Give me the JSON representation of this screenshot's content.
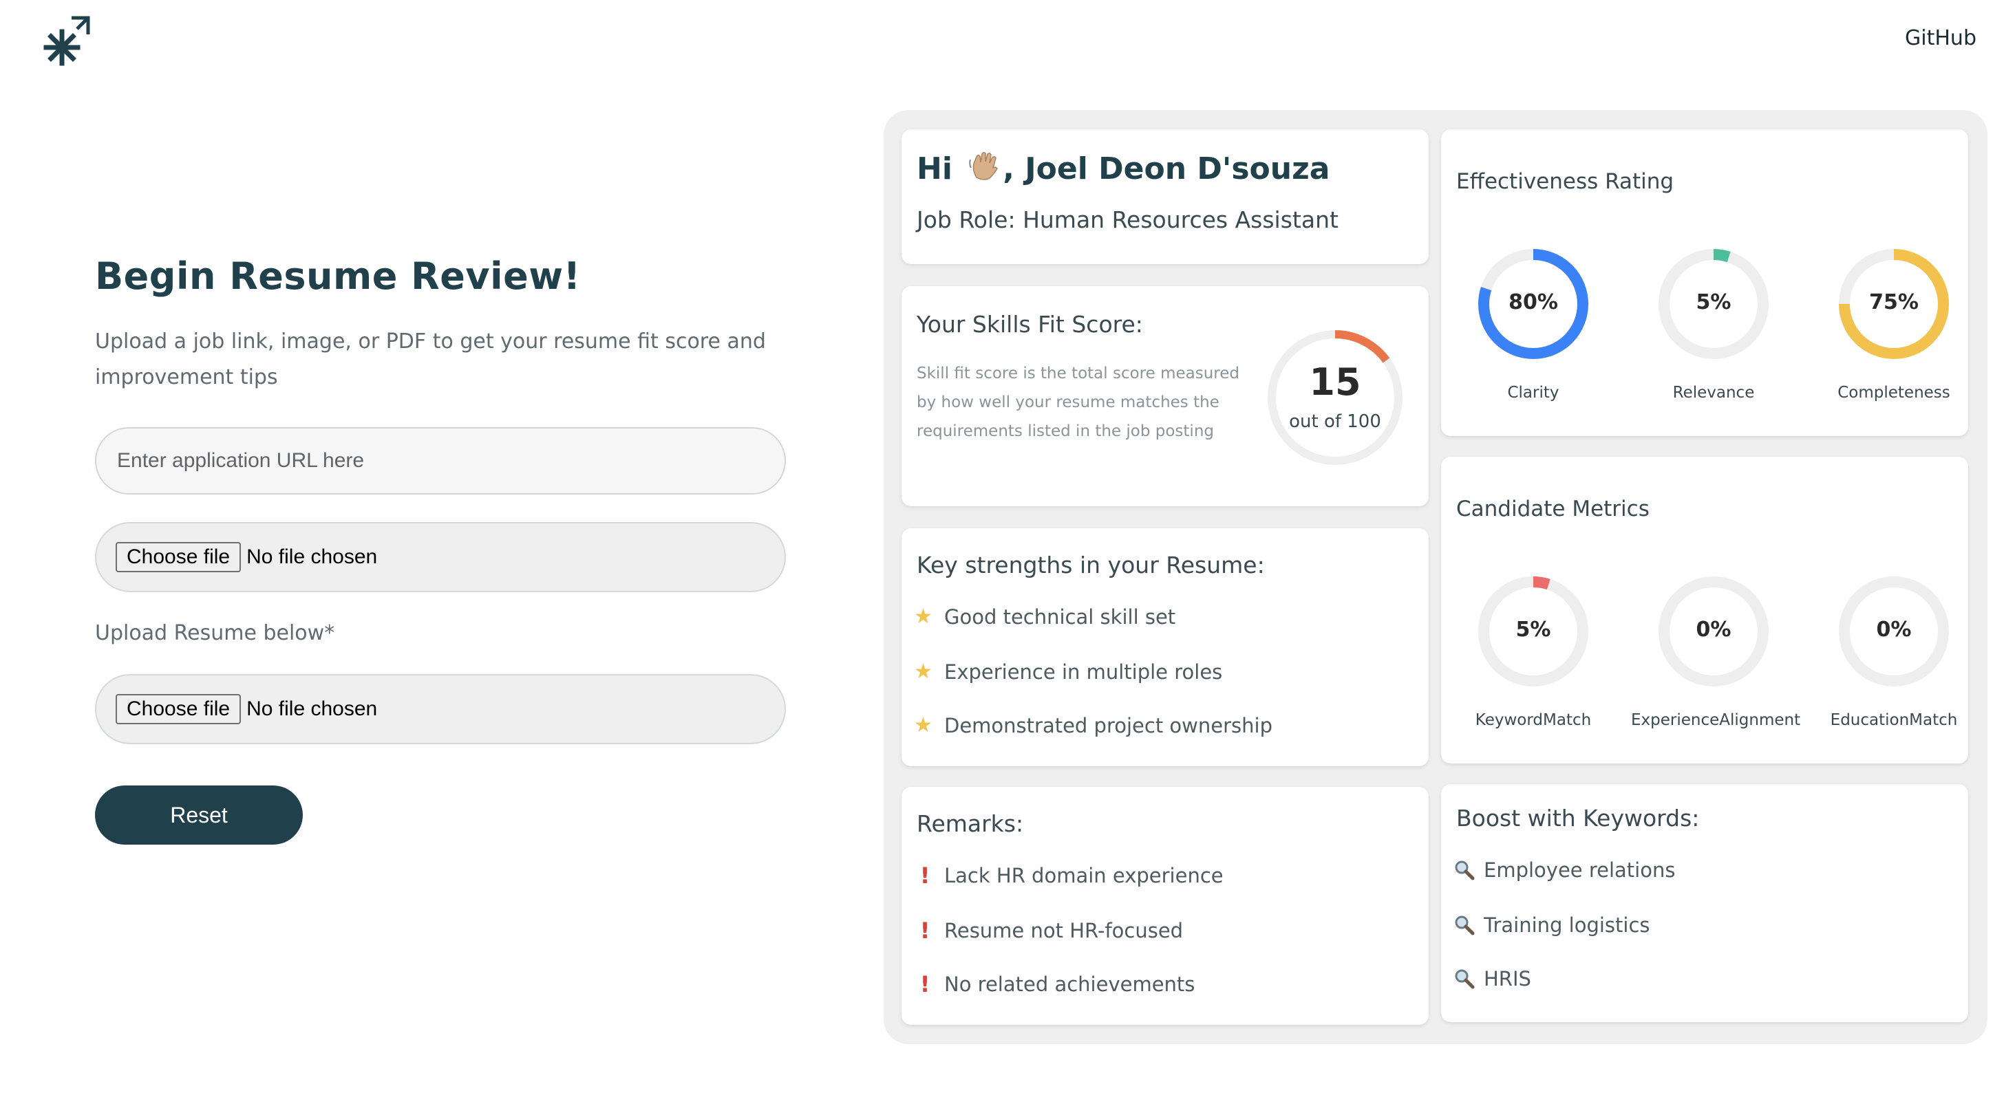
{
  "header": {
    "logo_icon": "asterisk-arrow-logo-icon",
    "github_label": "GitHub"
  },
  "form": {
    "title": "Begin Resume Review!",
    "subtitle": "Upload a job link, image, or PDF to get your resume fit score and improvement tips",
    "url_placeholder": "Enter application URL here",
    "file1_button": "Choose file",
    "file1_status": "No file chosen",
    "upload_label": "Upload Resume below*",
    "file2_button": "Choose file",
    "file2_status": "No file chosen",
    "reset_label": "Reset"
  },
  "greeting": {
    "prefix": "Hi",
    "wave_icon": "waving-hand-icon",
    "name": ", Joel Deon D'souza",
    "job_role": "Job Role: Human Resources Assistant"
  },
  "skills_fit": {
    "heading": "Your Skills Fit Score:",
    "description": "Skill fit score is the total score measured by how well your resume matches the requirements listed in the job posting",
    "score": "15",
    "score_of": "out of 100",
    "score_fraction": 0.15,
    "color": "#e8764a"
  },
  "strengths": {
    "heading": "Key strengths in your Resume:",
    "icon": "star-icon",
    "items": [
      "Good technical skill set",
      "Experience in multiple roles",
      "Demonstrated project ownership"
    ]
  },
  "remarks": {
    "heading": "Remarks:",
    "icon": "exclamation-icon",
    "items": [
      "Lack HR domain experience",
      "Resume not HR-focused",
      "No related achievements"
    ]
  },
  "effectiveness": {
    "heading": "Effectiveness Rating",
    "metrics": [
      {
        "label": "Clarity",
        "value": "80%",
        "fraction": 0.8,
        "color": "#3b82f6"
      },
      {
        "label": "Relevance",
        "value": "5%",
        "fraction": 0.05,
        "color": "#4cbf9a"
      },
      {
        "label": "Completeness",
        "value": "75%",
        "fraction": 0.75,
        "color": "#f2c14e"
      }
    ]
  },
  "candidate": {
    "heading": "Candidate Metrics",
    "metrics": [
      {
        "label": "KeywordMatch",
        "value": "5%",
        "fraction": 0.05,
        "color": "#ec6b6b"
      },
      {
        "label": "ExperienceAlignment",
        "value": "0%",
        "fraction": 0.0,
        "color": "#ec6b6b"
      },
      {
        "label": "EducationMatch",
        "value": "0%",
        "fraction": 0.0,
        "color": "#ec6b6b"
      }
    ]
  },
  "keywords": {
    "heading": "Boost with Keywords:",
    "icon": "magnifier-icon",
    "items": [
      "Employee relations",
      "Training logistics",
      "HRIS"
    ]
  }
}
